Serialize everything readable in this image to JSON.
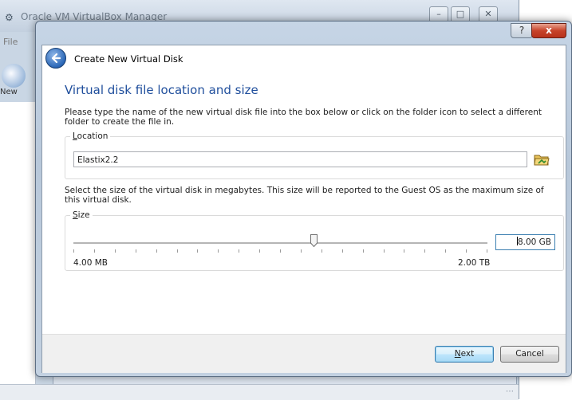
{
  "background_window": {
    "title": "Oracle VM VirtualBox Manager",
    "menu_first_item": "File",
    "toolbar_new_label": "New"
  },
  "dialog": {
    "help_button": "?",
    "close_button": "x",
    "header_title": "Create New Virtual Disk",
    "page_title": "Virtual disk file location and size",
    "location_description": "Please type the name of the new virtual disk file into the box below or click on the folder icon to select a different folder to create the file in.",
    "location_group": {
      "legend_underlined": "L",
      "legend_rest": "ocation",
      "value": "Elastix2.2"
    },
    "size_description": "Select the size of the virtual disk in megabytes. This size will be reported to the Guest OS as the maximum size of this virtual disk.",
    "size_group": {
      "legend_underlined": "S",
      "legend_rest": "ize",
      "min_label": "4.00 MB",
      "max_label": "2.00 TB",
      "value": "8.00 GB",
      "slider_level_fraction": 0.58
    },
    "buttons": {
      "next_underlined": "N",
      "next_rest": "ext",
      "cancel": "Cancel"
    }
  },
  "colors": {
    "title_blue": "#1f4e9c",
    "close_red": "#c7432a",
    "focus_blue": "#3c7fb1"
  },
  "icons": [
    "app-icon",
    "back-arrow-icon",
    "folder-icon",
    "new-vm-icon",
    "help-icon",
    "close-icon"
  ]
}
